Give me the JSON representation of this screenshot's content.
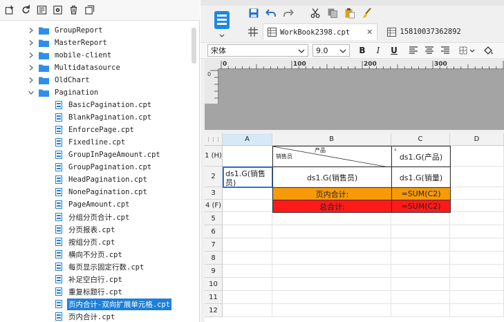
{
  "left_toolbar": {
    "icons": [
      "new-folder-icon",
      "refresh-icon",
      "locate-icon",
      "settings-icon",
      "delete-icon",
      "collapse-icon"
    ]
  },
  "tree": {
    "folders": [
      {
        "label": "GroupReport",
        "expanded": false
      },
      {
        "label": "MasterReport",
        "expanded": false
      },
      {
        "label": "mobile-client",
        "expanded": false
      },
      {
        "label": "Multidatasource",
        "expanded": false
      },
      {
        "label": "OldChart",
        "expanded": false
      },
      {
        "label": "Pagination",
        "expanded": true
      }
    ],
    "files": [
      "BasicPagination.cpt",
      "BlankPagination.cpt",
      "EnforcePage.cpt",
      "Fixedline.cpt",
      "GroupInPageAmount.cpt",
      "GroupPagination.cpt",
      "HeadPagination.cpt",
      "NonePagination.cpt",
      "PageAmount.cpt",
      "分组分页合计.cpt",
      "分页报表.cpt",
      "按组分页.cpt",
      "横向不分页.cpt",
      "每页显示固定行数.cpt",
      "补足空白行.cpt",
      "重复标题行.cpt",
      "页内合计-双向扩展单元格.cpt",
      "页内合计.cpt"
    ],
    "selected_file": "页内合计-双向扩展单元格.cpt"
  },
  "tabs": [
    {
      "label": "WorkBook2398.cpt",
      "active": true,
      "close": "✕"
    },
    {
      "label": "15810037362892",
      "active": false
    }
  ],
  "format": {
    "font": "宋体",
    "size": "9.0",
    "bold": "B",
    "italic": "I",
    "underline": "U"
  },
  "ruler": {
    "h_labels": [
      "0",
      "100",
      "200",
      "300"
    ],
    "v_labels": [
      "0"
    ]
  },
  "sheet": {
    "columns": [
      "A",
      "B",
      "C",
      "D"
    ],
    "rows": [
      "1 (H)",
      "2",
      "3",
      "4 (F)",
      "5",
      "6",
      "7",
      "8",
      "9",
      "10",
      "11",
      "12"
    ],
    "cells": {
      "b1_top": "产品",
      "b1_bottom": "销售员",
      "c1": "ds1.G(产品)",
      "a2": "ds1.G(销售员)",
      "b2": "ds1.G(销售员)",
      "c2": "ds1.G(销量)",
      "b3": "页内合计:",
      "c3": "=SUM(C2)",
      "b4": "总合计:",
      "c4": "=SUM(C2)"
    }
  }
}
